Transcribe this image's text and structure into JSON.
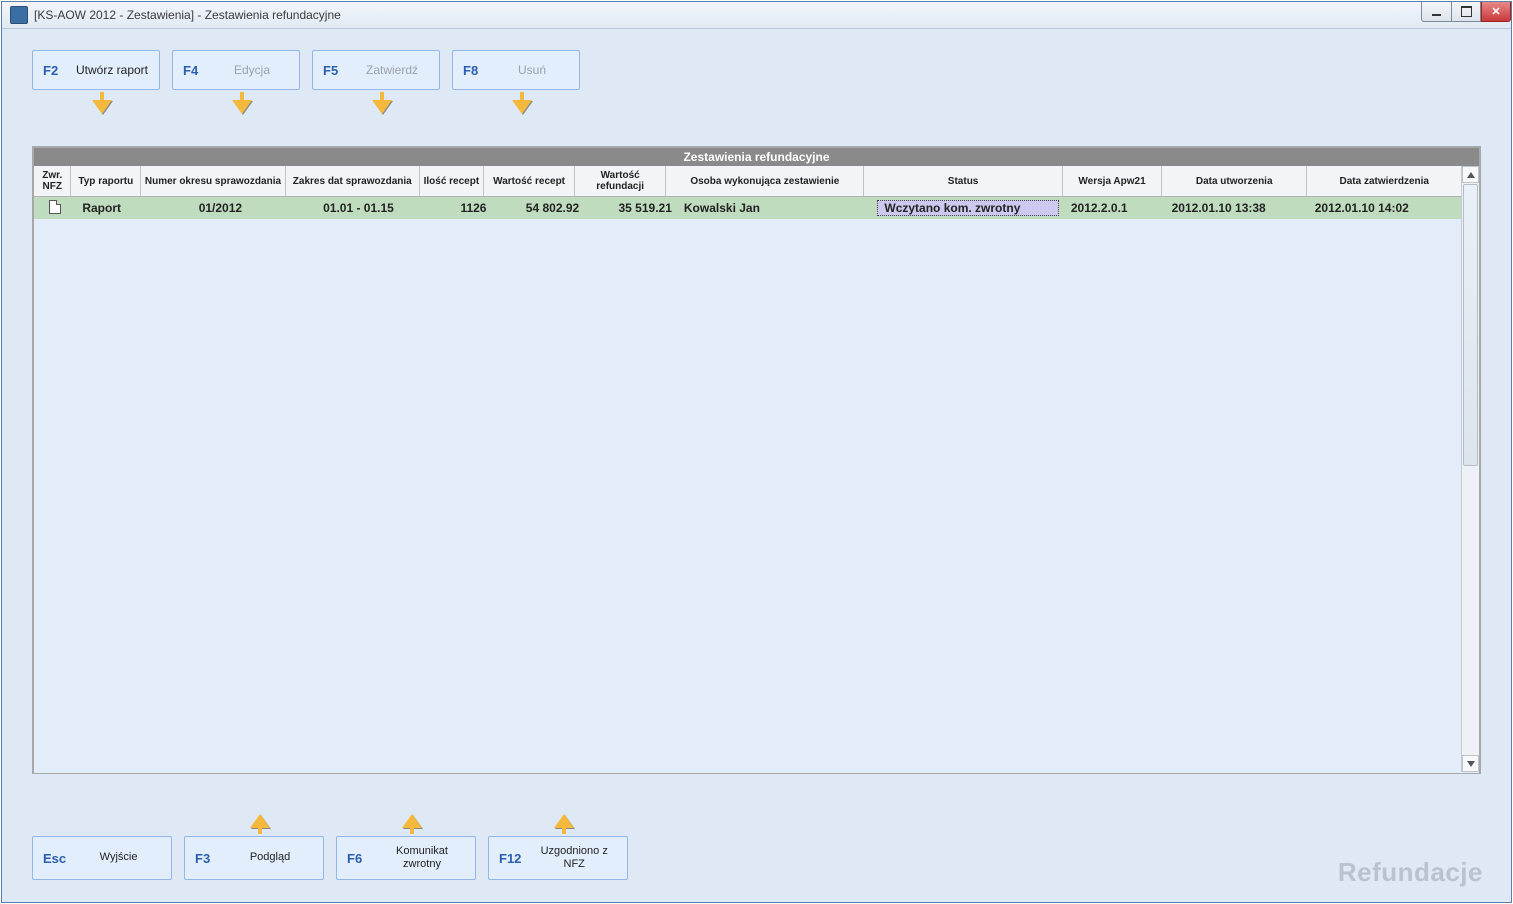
{
  "window": {
    "title": "[KS-AOW 2012 - Zestawienia] - Zestawienia refundacyjne"
  },
  "toolbar_top": {
    "f2": {
      "key": "F2",
      "label": "Utwórz raport"
    },
    "f4": {
      "key": "F4",
      "label": "Edycja"
    },
    "f5": {
      "key": "F5",
      "label": "Zatwierdź"
    },
    "f8": {
      "key": "F8",
      "label": "Usuń"
    }
  },
  "toolbar_bottom": {
    "esc": {
      "key": "Esc",
      "label": "Wyjście"
    },
    "f3": {
      "key": "F3",
      "label": "Podgląd"
    },
    "f6": {
      "key": "F6",
      "label": "Komunikat zwrotny"
    },
    "f12": {
      "key": "F12",
      "label": "Uzgodniono z NFZ"
    }
  },
  "panel": {
    "title": "Zestawienia refundacyjne",
    "columns": {
      "c0": "Zwr. NFZ",
      "c1": "Typ raportu",
      "c2": "Numer okresu sprawozdania",
      "c3": "Zakres dat sprawozdania",
      "c4": "Ilość recept",
      "c5": "Wartość recept",
      "c6": "Wartość refundacji",
      "c7": "Osoba wykonująca zestawienie",
      "c8": "Status",
      "c9": "Wersja Apw21",
      "c10": "Data utworzenia",
      "c11": "Data zatwierdzenia"
    },
    "rows": [
      {
        "typ": "Raport",
        "okres": "01/2012",
        "zakres": "01.01 - 01.15",
        "ilosc": "1126",
        "w_recept": "54 802.92",
        "w_refund": "35 519.21",
        "osoba": "Kowalski Jan",
        "status": "Wczytano kom. zwrotny",
        "wersja": "2012.2.0.1",
        "d_utw": "2012.01.10 13:38",
        "d_zat": "2012.01.10 14:02"
      }
    ]
  },
  "watermark": "Refundacje"
}
